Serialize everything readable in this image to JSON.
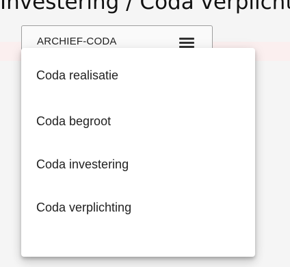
{
  "header": {
    "partial_title": "Investering / Coda verplichtin"
  },
  "menu": {
    "trigger_label": "ARCHIEF-CODA",
    "trigger_icon": "hamburger-menu-icon",
    "items": [
      {
        "label": "Coda realisatie"
      },
      {
        "label": "Coda begroot"
      },
      {
        "label": "Coda investering"
      },
      {
        "label": "Coda verplichting"
      }
    ]
  },
  "colors": {
    "background": "#f5f5f5",
    "menu_background": "#ffffff",
    "text": "#212121",
    "border": "#9e9e9e",
    "highlight_band": "#fbefef"
  }
}
